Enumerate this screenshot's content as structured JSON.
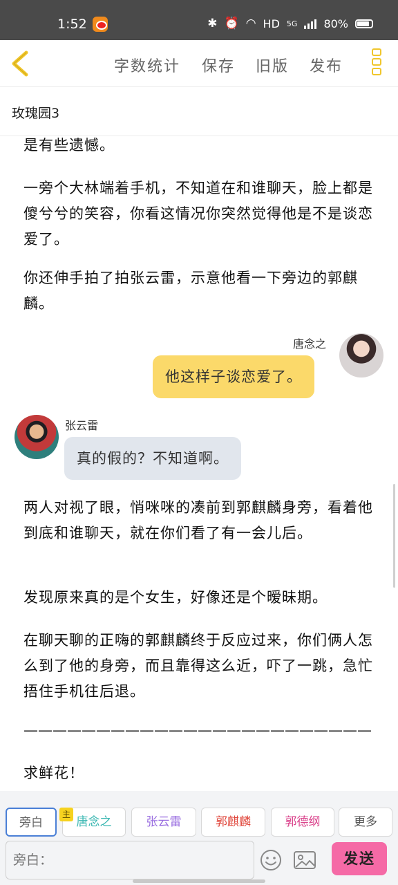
{
  "status_bar": {
    "time": "1:52",
    "network": "HD",
    "cellular": "5G",
    "battery": "80%"
  },
  "toolbar": {
    "word_count": "字数统计",
    "save": "保存",
    "old_version": "旧版",
    "publish": "发布"
  },
  "document": {
    "title": "玫瑰园3"
  },
  "content": {
    "para_1": "是有些遗憾。",
    "para_2": "一旁个大林端着手机，不知道在和谁聊天，脸上都是傻兮兮的笑容，你看这情况你突然觉得他是不是谈恋爱了。",
    "para_3": "你还伸手拍了拍张云雷，示意他看一下旁边的郭麒麟。",
    "msg_1": {
      "name": "唐念之",
      "text": "他这样子谈恋爱了。"
    },
    "msg_2": {
      "name": "张云雷",
      "text": "真的假的？不知道啊。"
    },
    "para_4": "两人对视了眼，悄咪咪的凑前到郭麒麟身旁，看着他到底和谁聊天，就在你们看了有一会儿后。",
    "para_5": "发现原来真的是个女生，好像还是个暧昧期。",
    "para_6": "在聊天聊的正嗨的郭麒麟终于反应过来，你们俩人怎么到了他的身旁，而且靠得这么近，吓了一跳，急忙捂住手机往后退。",
    "divider": "————————————————————————",
    "para_7": "求鲜花！"
  },
  "roles": {
    "host_badge": "主",
    "items": [
      {
        "label": "旁白",
        "color": "#666666"
      },
      {
        "label": "唐念之",
        "color": "#3ab7b2"
      },
      {
        "label": "张云雷",
        "color": "#9a6ee0"
      },
      {
        "label": "郭麒麟",
        "color": "#e0473c"
      },
      {
        "label": "郭德纲",
        "color": "#d9408a"
      },
      {
        "label": "更多",
        "color": "#555555"
      }
    ]
  },
  "input": {
    "placeholder": "旁白：",
    "send_label": "发送"
  },
  "colors": {
    "accent": "#f0c62c",
    "send": "#f56aa6",
    "bubble_right": "#fbd96a",
    "bubble_left": "#e1e6ed"
  }
}
